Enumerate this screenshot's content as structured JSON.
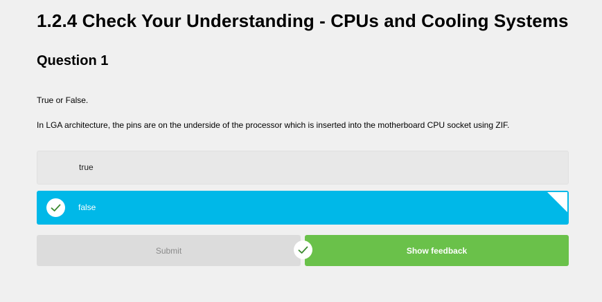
{
  "page": {
    "title": "1.2.4 Check Your Understanding - CPUs and Cooling Systems"
  },
  "question": {
    "heading": "Question 1",
    "prompt": "True or False.",
    "statement": "In LGA architecture, the pins are on the underside of the processor which is inserted into the motherboard CPU socket using ZIF."
  },
  "options": [
    {
      "label": "true",
      "selected": false
    },
    {
      "label": "false",
      "selected": true
    }
  ],
  "actions": {
    "submit_label": "Submit",
    "feedback_label": "Show feedback"
  },
  "icons": {
    "selected_option": "check-icon",
    "correct_result": "check-icon"
  },
  "colors": {
    "selected_bg": "#00b8e8",
    "feedback_bg": "#6ac14a",
    "check_color": "#3a8a2e"
  }
}
